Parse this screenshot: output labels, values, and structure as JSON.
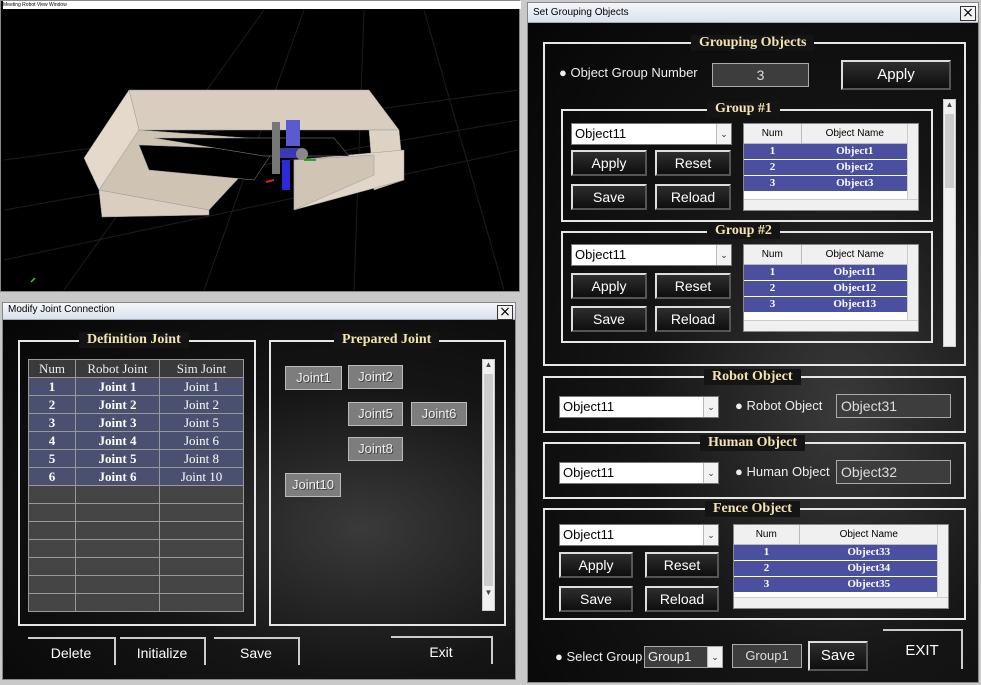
{
  "viewer": {
    "title": "Meeting Robot View Window"
  },
  "joint_window": {
    "title": "Modify Joint Connection",
    "definition_label": "Definition Joint",
    "prepared_label": "Prepared Joint",
    "columns": [
      "Num",
      "Robot Joint",
      "Sim Joint"
    ],
    "rows": [
      {
        "num": "1",
        "robot": "Joint 1",
        "sim": "Joint 1"
      },
      {
        "num": "2",
        "robot": "Joint 2",
        "sim": "Joint 2"
      },
      {
        "num": "3",
        "robot": "Joint 3",
        "sim": "Joint 5"
      },
      {
        "num": "4",
        "robot": "Joint 4",
        "sim": "Joint 6"
      },
      {
        "num": "5",
        "robot": "Joint 5",
        "sim": "Joint 8"
      },
      {
        "num": "6",
        "robot": "Joint 6",
        "sim": "Joint 10"
      }
    ],
    "prepared_joints": [
      "Joint1",
      "Joint2",
      "Joint5",
      "Joint6",
      "Joint8",
      "Joint10"
    ],
    "buttons": {
      "delete": "Delete",
      "initialize": "Initialize",
      "save": "Save",
      "exit": "Exit"
    }
  },
  "group_window": {
    "title": "Set Grouping Objects",
    "grouping_label": "Grouping Objects",
    "group_number_label": "Object Group Number",
    "group_number_value": "3",
    "apply": "Apply",
    "groups": [
      {
        "label": "Group #1",
        "combo": "Object11",
        "buttons": {
          "apply": "Apply",
          "reset": "Reset",
          "save": "Save",
          "reload": "Reload"
        },
        "columns": [
          "Num",
          "Object Name"
        ],
        "rows": [
          {
            "num": "1",
            "name": "Object1"
          },
          {
            "num": "2",
            "name": "Object2"
          },
          {
            "num": "3",
            "name": "Object3"
          }
        ]
      },
      {
        "label": "Group #2",
        "combo": "Object11",
        "buttons": {
          "apply": "Apply",
          "reset": "Reset",
          "save": "Save",
          "reload": "Reload"
        },
        "columns": [
          "Num",
          "Object Name"
        ],
        "rows": [
          {
            "num": "1",
            "name": "Object11"
          },
          {
            "num": "2",
            "name": "Object12"
          },
          {
            "num": "3",
            "name": "Object13"
          }
        ]
      }
    ],
    "robot": {
      "label": "Robot Object",
      "combo": "Object11",
      "field_label": "Robot Object",
      "field_value": "Object31"
    },
    "human": {
      "label": "Human Object",
      "combo": "Object11",
      "field_label": "Human Object",
      "field_value": "Object32"
    },
    "fence": {
      "label": "Fence Object",
      "combo": "Object11",
      "buttons": {
        "apply": "Apply",
        "reset": "Reset",
        "save": "Save",
        "reload": "Reload"
      },
      "columns": [
        "Num",
        "Object Name"
      ],
      "rows": [
        {
          "num": "1",
          "name": "Object33"
        },
        {
          "num": "2",
          "name": "Object34"
        },
        {
          "num": "3",
          "name": "Object35"
        }
      ]
    },
    "select_group_label": "Select Group",
    "select_group_combo": "Group1",
    "select_group_field": "Group1",
    "save": "Save",
    "exit": "EXIT"
  },
  "close_glyph": "×",
  "dropdown_glyph": "⌄",
  "colors": {
    "table_highlight": "#4a4fa0",
    "label_text": "#f3e3b0"
  }
}
